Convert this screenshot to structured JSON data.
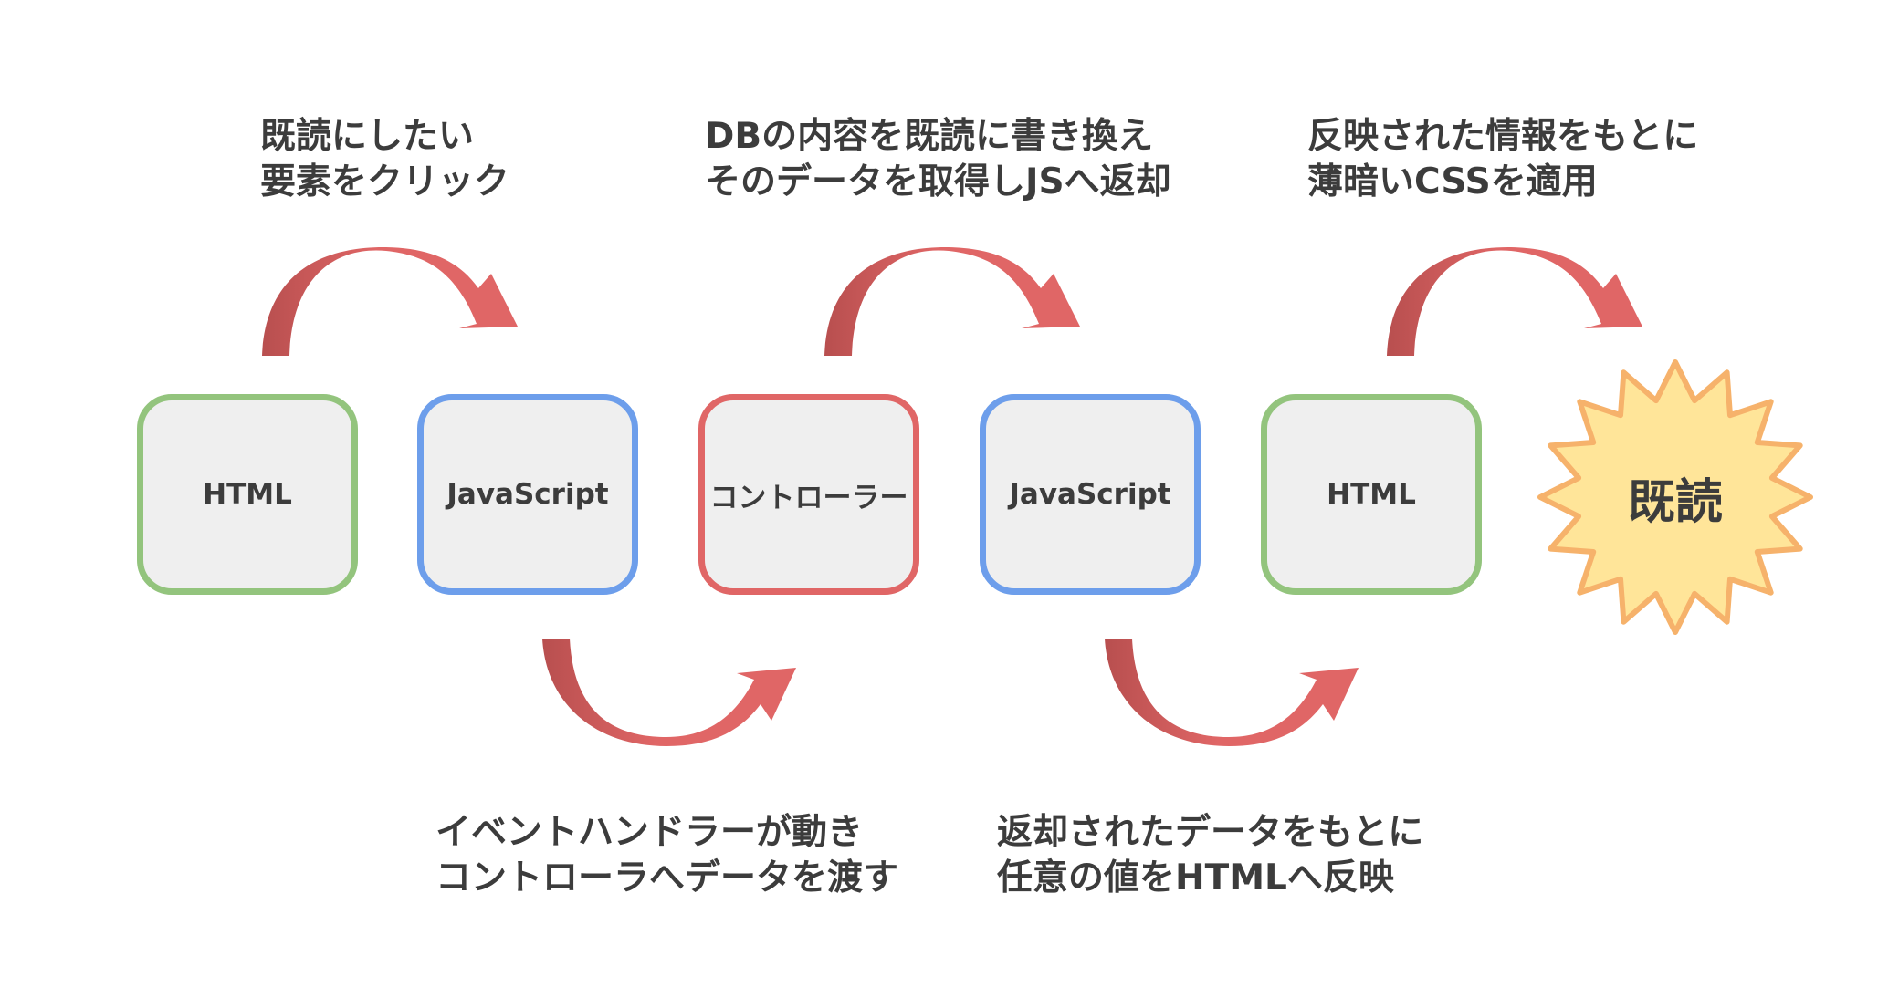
{
  "diagram": {
    "nodes": [
      {
        "label": "HTML"
      },
      {
        "label": "JavaScript"
      },
      {
        "label": "コントローラー"
      },
      {
        "label": "JavaScript"
      },
      {
        "label": "HTML"
      }
    ],
    "result_label": "既読",
    "captions": {
      "step1": {
        "line1": "既読にしたい",
        "line2": "要素をクリック"
      },
      "step2": {
        "line1": "イベントハンドラーが動き",
        "line2": "コントローラへデータを渡す"
      },
      "step3": {
        "line1": "DBの内容を既読に書き換え",
        "line2": "そのデータを取得しJSへ返却"
      },
      "step4": {
        "line1": "返却されたデータをもとに",
        "line2": "任意の値をHTMLへ反映"
      },
      "step5": {
        "line1": "反映された情報をもとに",
        "line2": "薄暗いCSSを適用"
      }
    },
    "colors": {
      "html_border": "#93c47d",
      "js_border": "#6d9eeb",
      "controller_border": "#e06666",
      "node_fill": "#efefef",
      "arrow_fill": "#e06666",
      "arrow_shadow": "#b84f4f",
      "burst_fill": "#ffe599",
      "burst_stroke": "#f6b26b",
      "text": "#3c3c3c"
    }
  }
}
